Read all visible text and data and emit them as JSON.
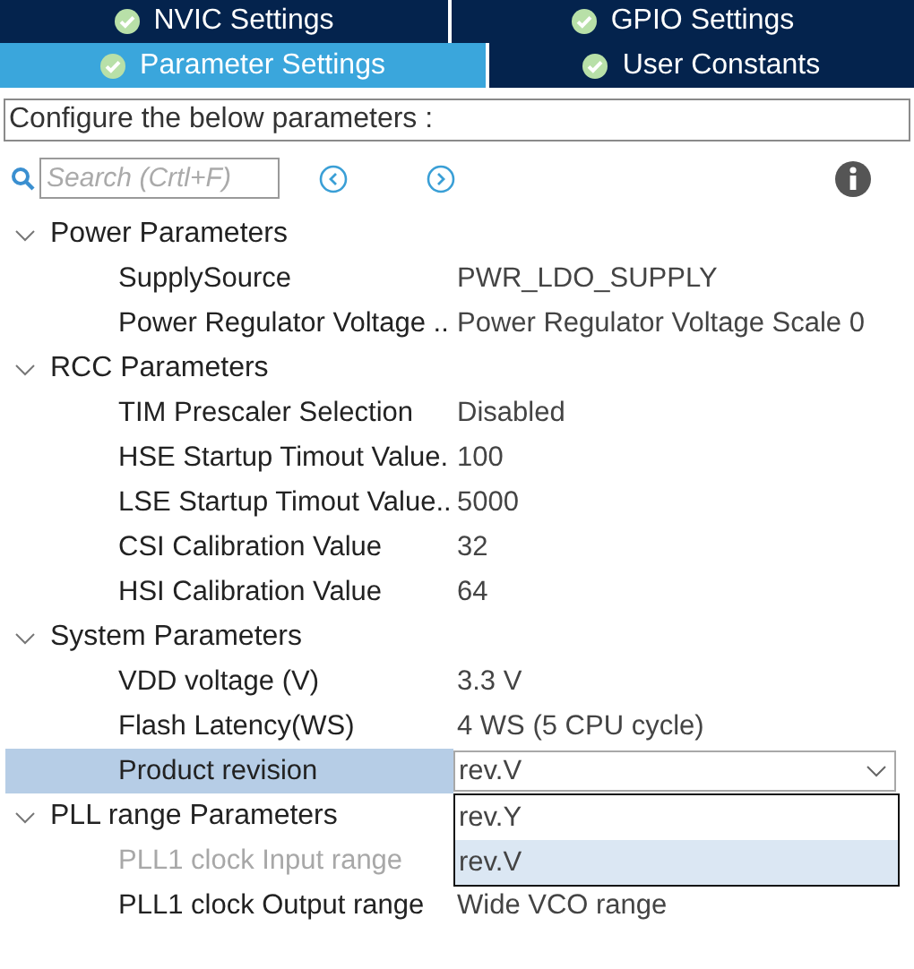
{
  "tab_rows": [
    {
      "tabs": [
        {
          "label": "NVIC Settings",
          "selected": false
        },
        {
          "label": "GPIO Settings",
          "selected": false
        }
      ]
    },
    {
      "tabs": [
        {
          "label": "Parameter Settings",
          "selected": true
        },
        {
          "label": "User Constants",
          "selected": false
        }
      ]
    }
  ],
  "heading": "Configure the below parameters :",
  "search": {
    "placeholder": "Search (Crtl+F)"
  },
  "groups": [
    {
      "label": "Power Parameters",
      "expanded": true,
      "children": [
        {
          "label": "SupplySource",
          "value": "PWR_LDO_SUPPLY",
          "disabled": false,
          "selected": false,
          "kind": "text"
        },
        {
          "label": "Power Regulator Voltage ..",
          "value": "Power Regulator Voltage Scale 0",
          "disabled": false,
          "selected": false,
          "kind": "text"
        }
      ]
    },
    {
      "label": "RCC Parameters",
      "expanded": true,
      "children": [
        {
          "label": "TIM Prescaler Selection",
          "value": "Disabled",
          "disabled": false,
          "selected": false,
          "kind": "text"
        },
        {
          "label": "HSE Startup Timout Value.",
          "value": "100",
          "disabled": false,
          "selected": false,
          "kind": "text"
        },
        {
          "label": "LSE Startup Timout Value..",
          "value": "5000",
          "disabled": false,
          "selected": false,
          "kind": "text"
        },
        {
          "label": "CSI Calibration Value",
          "value": "32",
          "disabled": false,
          "selected": false,
          "kind": "text"
        },
        {
          "label": "HSI Calibration Value",
          "value": "64",
          "disabled": false,
          "selected": false,
          "kind": "text"
        }
      ]
    },
    {
      "label": "System Parameters",
      "expanded": true,
      "children": [
        {
          "label": "VDD voltage (V)",
          "value": "3.3 V",
          "disabled": false,
          "selected": false,
          "kind": "text"
        },
        {
          "label": "Flash Latency(WS)",
          "value": "4 WS (5 CPU cycle)",
          "disabled": false,
          "selected": false,
          "kind": "text"
        },
        {
          "label": "Product revision",
          "value": "rev.V",
          "disabled": false,
          "selected": true,
          "kind": "dropdown",
          "open": true,
          "options": [
            {
              "label": "rev.Y",
              "selected": false
            },
            {
              "label": "rev.V",
              "selected": true
            }
          ]
        }
      ]
    },
    {
      "label": "PLL range Parameters",
      "expanded": true,
      "children": [
        {
          "label": "PLL1 clock Input range",
          "disabled": true,
          "selected": false,
          "kind": "text"
        },
        {
          "label": "PLL1 clock Output range",
          "value": "Wide VCO range",
          "disabled": false,
          "selected": false,
          "kind": "text"
        }
      ]
    }
  ]
}
